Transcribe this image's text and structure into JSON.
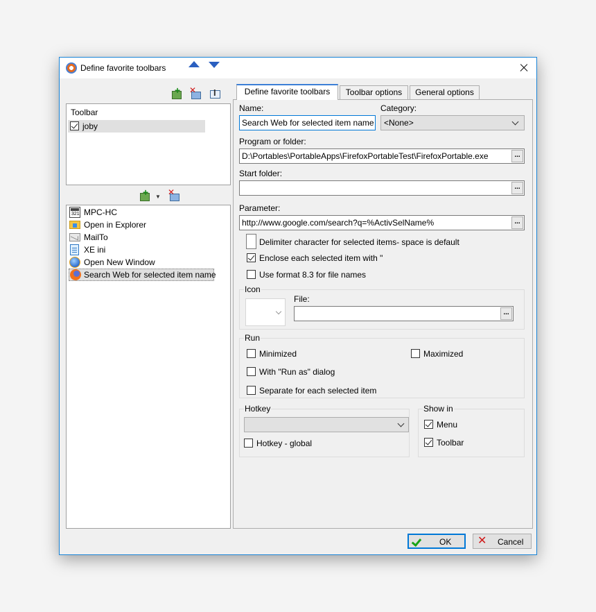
{
  "window": {
    "title": "Define favorite toolbars"
  },
  "toolbars_panel": {
    "header": "Toolbar",
    "items": [
      {
        "label": "joby",
        "checked": true
      }
    ]
  },
  "commands_panel": {
    "items": [
      {
        "label": "MPC-HC",
        "icon": "mpc-icon"
      },
      {
        "label": "Open in Explorer",
        "icon": "folder-icon"
      },
      {
        "label": "MailTo",
        "icon": "mail-icon"
      },
      {
        "label": "XE ini",
        "icon": "notepad-icon"
      },
      {
        "label": "Open New Window",
        "icon": "globe-icon"
      },
      {
        "label": "Search Web for selected item name",
        "icon": "firefox-icon",
        "selected": true
      }
    ]
  },
  "tabs": [
    {
      "label": "Define favorite toolbars",
      "active": true
    },
    {
      "label": "Toolbar options"
    },
    {
      "label": "General options"
    }
  ],
  "form": {
    "name_label": "Name:",
    "name_value": "Search Web for selected item name",
    "category_label": "Category:",
    "category_value": "<None>",
    "program_label": "Program or folder:",
    "program_value": "D:\\Portables\\PortableApps\\FirefoxPortableTest\\FirefoxPortable.exe",
    "start_folder_label": "Start folder:",
    "start_folder_value": "",
    "parameter_label": "Parameter:",
    "parameter_value": "http://www.google.com/search?q=%ActivSelName%",
    "browse_label": "...",
    "delimiter_label": "Delimiter character for selected items- space is default",
    "enclose_label": "Enclose each selected item with \"",
    "enclose_checked": true,
    "format83_label": "Use format 8.3 for file names",
    "format83_checked": false
  },
  "icon_group": {
    "title": "Icon",
    "file_label": "File:",
    "file_value": ""
  },
  "run_group": {
    "title": "Run",
    "minimized": "Minimized",
    "maximized": "Maximized",
    "run_as": "With \"Run as\" dialog",
    "separate": "Separate for each selected item"
  },
  "hotkey_group": {
    "title": "Hotkey",
    "value": "",
    "global_label": "Hotkey - global"
  },
  "show_in_group": {
    "title": "Show in",
    "menu": "Menu",
    "menu_checked": true,
    "toolbar": "Toolbar",
    "toolbar_checked": true
  },
  "buttons": {
    "ok": "OK",
    "cancel": "Cancel"
  },
  "colors": {
    "accent": "#0078d7",
    "window_border": "#1883d7",
    "selection": "#e0e0e0"
  }
}
